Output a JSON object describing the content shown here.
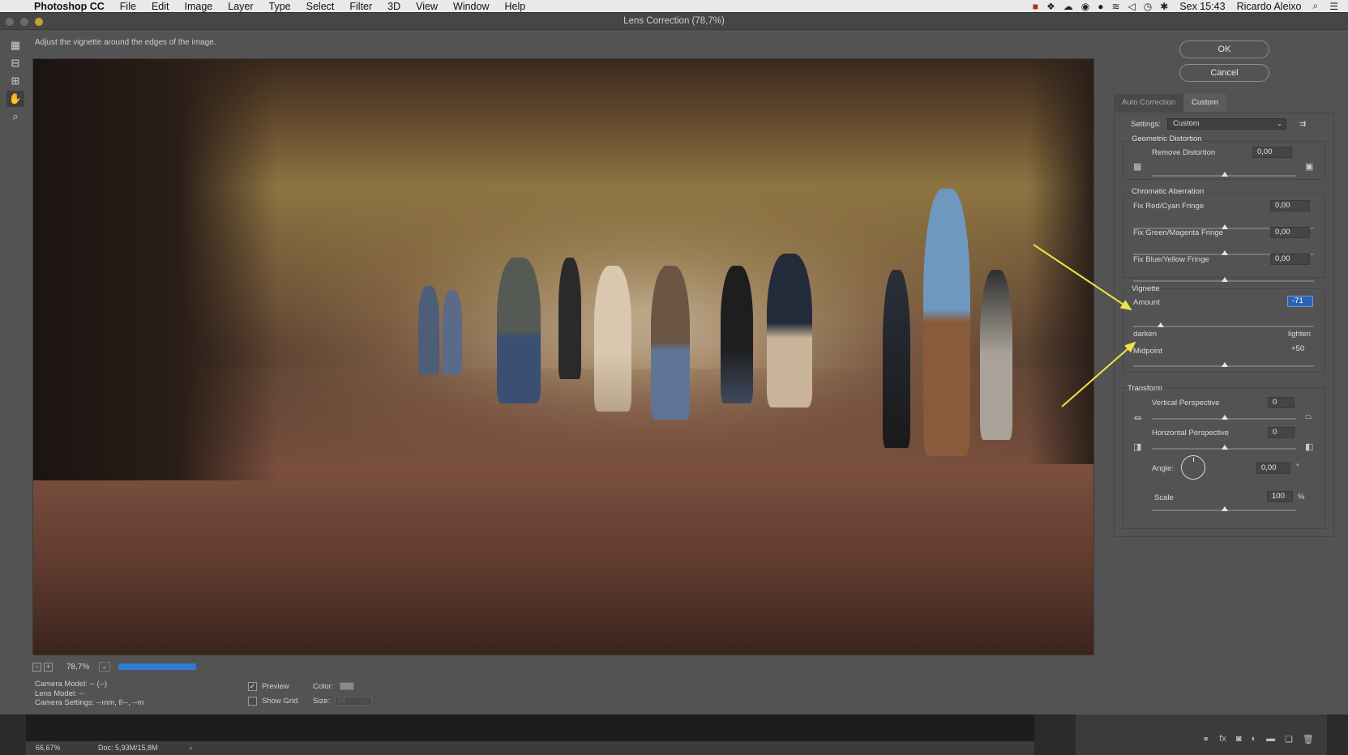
{
  "menubar": {
    "app": "Photoshop CC",
    "items": [
      "File",
      "Edit",
      "Image",
      "Layer",
      "Type",
      "Select",
      "Filter",
      "3D",
      "View",
      "Window",
      "Help"
    ],
    "clock": "Sex 15:43",
    "user": "Ricardo Aleixo"
  },
  "dialog": {
    "title": "Lens Correction (78,7%)",
    "hint": "Adjust the vignette around the edges of the image.",
    "zoom": "78,7%",
    "camera_model": "Camera Model: -- (--)",
    "lens_model": "Lens Model: --",
    "camera_settings": "Camera Settings: --mm, f/--, --m",
    "preview_label": "Preview",
    "preview_checked": true,
    "show_grid_label": "Show Grid",
    "show_grid_checked": false,
    "color_label": "Color:",
    "size_label": "Size:",
    "size_value": "64"
  },
  "buttons": {
    "ok": "OK",
    "cancel": "Cancel"
  },
  "tabs": [
    "Auto Correction",
    "Custom"
  ],
  "active_tab": "Custom",
  "settings": {
    "label": "Settings:",
    "value": "Custom"
  },
  "geometric": {
    "title": "Geometric Distortion",
    "remove_label": "Remove Distortion",
    "remove_value": "0,00"
  },
  "chromatic": {
    "title": "Chromatic Aberration",
    "rows": [
      {
        "label": "Fix Red/Cyan Fringe",
        "value": "0,00"
      },
      {
        "label": "Fix Green/Magenta Fringe",
        "value": "0,00"
      },
      {
        "label": "Fix Blue/Yellow Fringe",
        "value": "0,00"
      }
    ]
  },
  "vignette": {
    "title": "Vignette",
    "amount_label": "Amount",
    "amount_value": "-71",
    "darken": "darken",
    "lighten": "lighten",
    "midpoint_label": "Midpoint",
    "midpoint_value": "+50"
  },
  "transform": {
    "title": "Transform",
    "vertical_label": "Vertical Perspective",
    "vertical_value": "0",
    "horizontal_label": "Horizontal Perspective",
    "horizontal_value": "0",
    "angle_label": "Angle:",
    "angle_value": "0,00",
    "angle_unit": "°",
    "scale_label": "Scale",
    "scale_value": "100",
    "scale_unit": "%"
  },
  "statusbar": {
    "zoom": "66,67%",
    "doc": "Doc: 5,93M/15,8M"
  },
  "colors": {
    "accent": "#2e7bd3",
    "annotation_arrow": "#f0e14a"
  }
}
